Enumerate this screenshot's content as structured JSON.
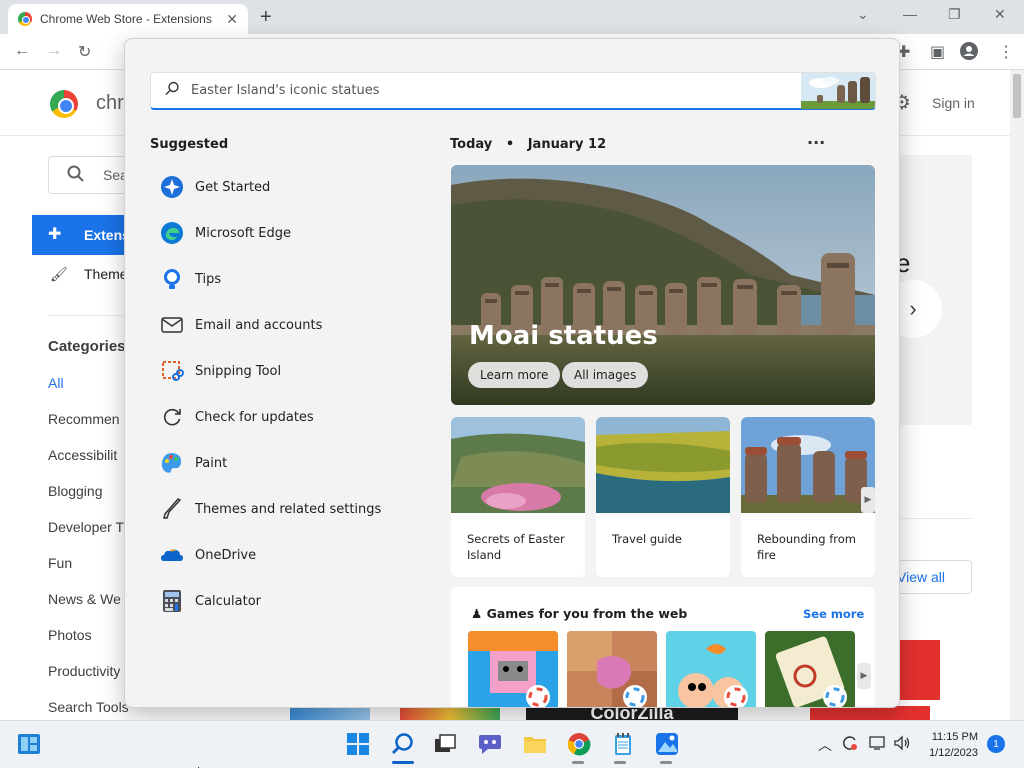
{
  "browser": {
    "tab_title": "Chrome Web Store - Extensions",
    "new_tab": "+",
    "tab_close": "✕",
    "window_controls": [
      "⌄",
      "—",
      "❐",
      "✕"
    ]
  },
  "cws": {
    "title": "chr",
    "sign_in": "Sign in",
    "search_placeholder": "Sea",
    "nav_extensions": "Extens",
    "nav_themes": "Theme",
    "categories_title": "Categories",
    "categories": [
      "All",
      "Recommen",
      "Accessibilit",
      "Blogging",
      "Developer T",
      "Fun",
      "News & We",
      "Photos",
      "Productivity",
      "Search Tools"
    ],
    "hero_partial_text": "e",
    "view_all": "View all",
    "bottom_banner_text": "ColorZilla"
  },
  "start": {
    "search_value": "Easter Island's iconic statues",
    "suggested_title": "Suggested",
    "suggested": [
      {
        "label": "Get Started",
        "icon": "get-started-icon"
      },
      {
        "label": "Microsoft Edge",
        "icon": "edge-icon"
      },
      {
        "label": "Tips",
        "icon": "tips-icon"
      },
      {
        "label": "Email and accounts",
        "icon": "mail-icon"
      },
      {
        "label": "Snipping Tool",
        "icon": "snipping-tool-icon"
      },
      {
        "label": "Check for updates",
        "icon": "refresh-icon"
      },
      {
        "label": "Paint",
        "icon": "paint-icon"
      },
      {
        "label": "Themes and related settings",
        "icon": "brush-icon"
      },
      {
        "label": "OneDrive",
        "icon": "onedrive-icon"
      },
      {
        "label": "Calculator",
        "icon": "calculator-icon"
      }
    ],
    "today_label": "Today",
    "date_label": "January 12",
    "hero_title": "Moai statues",
    "hero_buttons": [
      "Learn more",
      "All images"
    ],
    "cards": [
      "Secrets of Easter Island",
      "Travel guide",
      "Rebounding from fire"
    ],
    "games_title": "Games for you from the web",
    "games_see_more": "See more"
  },
  "taskbar": {
    "time": "11:15 PM",
    "date": "1/12/2023",
    "notification_count": "1"
  },
  "colors": {
    "accent": "#1a73e8",
    "start_bg": "#f3f3f3",
    "taskbar_bg": "#eef1f6"
  }
}
